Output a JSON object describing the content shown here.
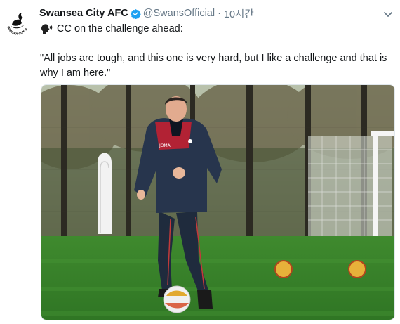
{
  "tweet": {
    "account_name": "Swansea City AFC",
    "handle": "@SwansOfficial",
    "separator": "·",
    "time": "10시간",
    "line1": "CC on the challenge ahead:",
    "quote": "\"All jobs are tough, and this one is very hard, but I like a challenge and that is why I am here.\"",
    "avatar_text": "SWANSEA CITY AFC",
    "jacket_text": "JOMA",
    "icons": {
      "verified": "verified-badge-icon",
      "caret": "chevron-down-icon",
      "emoji": "speaking-head-icon"
    }
  },
  "colors": {
    "verified_blue": "#1da1f2",
    "secondary_text": "#657786",
    "primary_text": "#14171a"
  }
}
